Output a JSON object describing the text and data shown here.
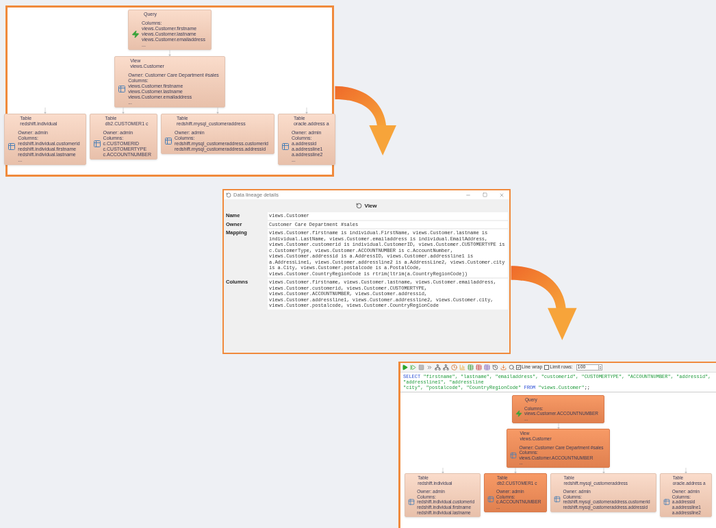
{
  "overview_diagram": {
    "root": {
      "kind": "query",
      "highlighted": false,
      "header": [
        "Query"
      ],
      "body": [
        "Columns:",
        "views.Customer.firstname",
        "views.Customer.lastname",
        "views.Customer.emailaddress",
        "..."
      ],
      "children": [
        {
          "kind": "table",
          "highlighted": false,
          "header": [
            "View",
            "views.Customer"
          ],
          "body": [
            "Owner: Customer Care Department #sales",
            "Columns:",
            "views.Customer.firstname",
            "views.Customer.lastname",
            "views.Customer.emailaddress",
            "..."
          ],
          "children": [
            {
              "kind": "table",
              "highlighted": false,
              "header": [
                "Table",
                "redshift.individual"
              ],
              "body": [
                "Owner: admin",
                "Columns:",
                "redshift.individual.customerid",
                "redshift.individual.firstname",
                "redshift.individual.lastname",
                "..."
              ]
            },
            {
              "kind": "table",
              "highlighted": false,
              "header": [
                "Table",
                "db2.CUSTOMER1 c"
              ],
              "body": [
                "Owner: admin",
                "Columns:",
                "c.CUSTOMERID",
                "c.CUSTOMERTYPE",
                "c.ACCOUNTNUMBER"
              ]
            },
            {
              "kind": "table",
              "highlighted": false,
              "header": [
                "Table",
                "redshift.mysql_customeraddress"
              ],
              "body": [
                "Owner: admin",
                "Columns:",
                "redshift.mysql_customeraddress.customerid",
                "redshift.mysql_customeraddress.addressid"
              ]
            },
            {
              "kind": "table",
              "highlighted": false,
              "header": [
                "Table",
                "oracle.address a"
              ],
              "body": [
                "Owner: admin",
                "Columns:",
                "a.addressid",
                "a.addressline1",
                "a.addressline2",
                "..."
              ]
            }
          ]
        }
      ]
    }
  },
  "details_window": {
    "title": "Data lineage details",
    "heading": "View",
    "fields": [
      {
        "label": "Name",
        "value": "views.Customer"
      },
      {
        "label": "Owner",
        "value": "Customer Care Department #sales"
      },
      {
        "label": "Mapping",
        "value": "views.Customer.firstname is individual.FirstName, views.Customer.lastname is individual.LastName, views.Customer.emailaddress is individual.EmailAddress, views.Customer.customerid is individual.CustomerID, views.Customer.CUSTOMERTYPE is c.CustomerType, views.Customer.ACCOUNTNUMBER is c.AccountNumber, views.Customer.addressid is a.AddressID, views.Customer.addressline1 is a.AddressLine1, views.Customer.addressline2 is a.AddressLine2, views.Customer.city is a.City, views.Customer.postalcode is a.PostalCode, views.Customer.CountryRegionCode is rtrim(ltrim(a.CountryRegionCode))"
      },
      {
        "label": "Columns",
        "value": "views.Customer.firstname, views.Customer.lastname, views.Customer.emailaddress, views.Customer.customerid, views.Customer.CUSTOMERTYPE, views.Customer.ACCOUNTNUMBER, views.Customer.addressid, views.Customer.addressline1, views.Customer.addressline2, views.Customer.city, views.Customer.postalcode, views.Customer.CountryRegionCode"
      }
    ]
  },
  "query_editor": {
    "toolbar": {
      "line_wrap": {
        "label": "Line wrap",
        "checked": true
      },
      "limit_rows": {
        "label": "Limit rows:",
        "checked": false
      },
      "row_limit": "100"
    },
    "sql_lines": [
      [
        {
          "kind": "keyword",
          "text": "SELECT"
        },
        {
          "kind": "string",
          "text": " \"firstname\", \"lastname\", \"emailaddress\", \"customerid\", \"CUSTOMERTYPE\", \"ACCOUNTNUMBER\", \"addressid\", \"addressline1\", \"addressline"
        }
      ],
      [
        {
          "kind": "string",
          "text": "\"city\", \"postalcode\", \"CountryRegionCode\""
        },
        {
          "kind": "keyword",
          "text": " FROM"
        },
        {
          "kind": "string",
          "text": " \"views.Customer\""
        },
        {
          "kind": "plain",
          "text": ";;"
        }
      ]
    ],
    "diagram": {
      "root": {
        "kind": "query",
        "highlighted": true,
        "header": [
          "Query"
        ],
        "body": [
          "Columns:",
          "views.Customer.ACCOUNTNUMBER",
          "..."
        ],
        "children": [
          {
            "kind": "table",
            "highlighted": true,
            "header": [
              "View",
              "views.Customer"
            ],
            "body": [
              "Owner: Customer Care Department #sales",
              "Columns:",
              "views.Customer.ACCOUNTNUMBER",
              "..."
            ],
            "children": [
              {
                "kind": "table",
                "highlighted": false,
                "header": [
                  "Table",
                  "redshift.individual"
                ],
                "body": [
                  "Owner: admin",
                  "Columns:",
                  "redshift.individual.customerid",
                  "redshift.individual.firstname",
                  "redshift.individual.lastname"
                ]
              },
              {
                "kind": "table",
                "highlighted": true,
                "header": [
                  "Table",
                  "db2.CUSTOMER1 c"
                ],
                "body": [
                  "Owner: admin",
                  "Columns:",
                  "c.ACCOUNTNUMBER",
                  "..."
                ]
              },
              {
                "kind": "table",
                "highlighted": false,
                "header": [
                  "Table",
                  "redshift.mysql_customeraddress"
                ],
                "body": [
                  "Owner: admin",
                  "Columns:",
                  "redshift.mysql_customeraddress.customerid",
                  "redshift.mysql_customeraddress.addressid"
                ]
              },
              {
                "kind": "table",
                "highlighted": false,
                "header": [
                  "Table",
                  "oracle.address a"
                ],
                "body": [
                  "Owner: admin",
                  "Columns:",
                  "a.addressid",
                  "a.addressline1",
                  "a.addressline2"
                ]
              }
            ]
          }
        ]
      }
    }
  }
}
